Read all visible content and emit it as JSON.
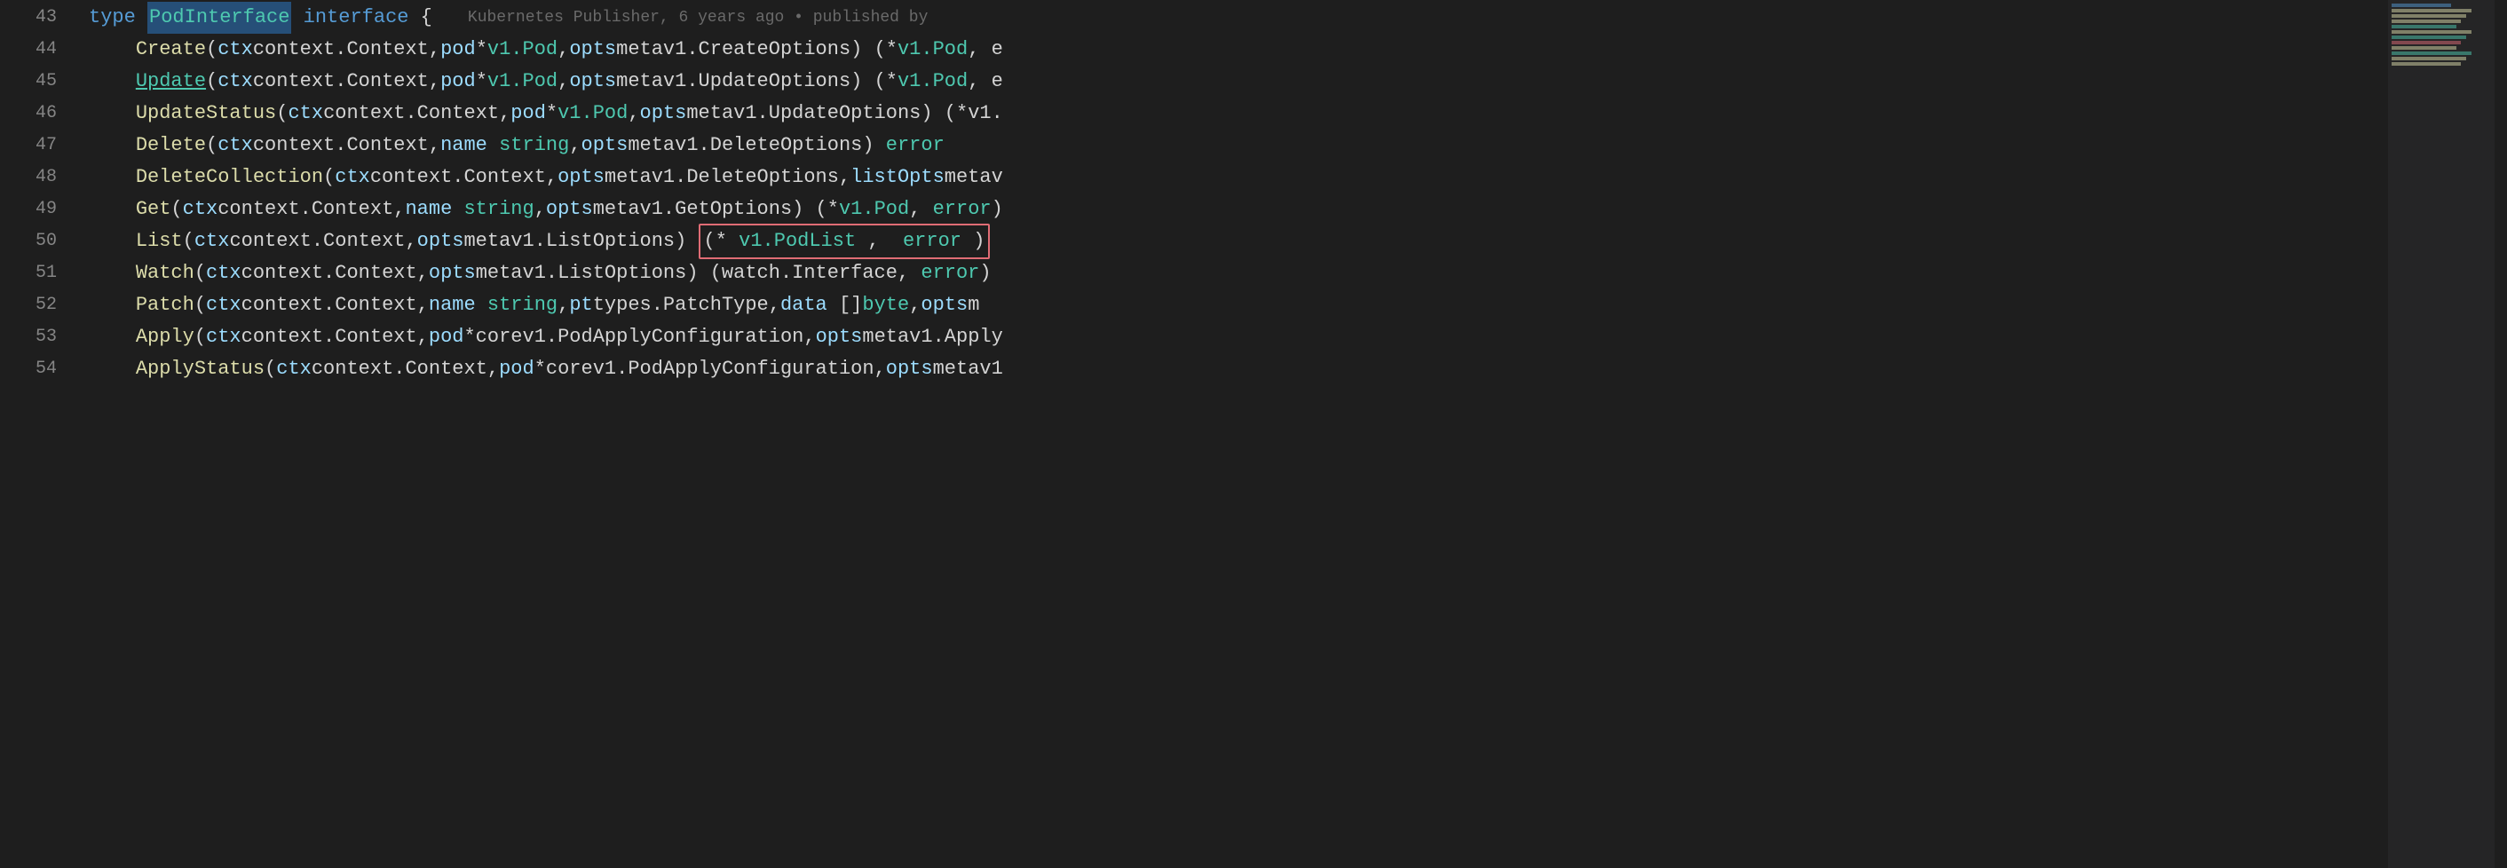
{
  "editor": {
    "background": "#1e1e1e",
    "font_size": "22px"
  },
  "blame": {
    "line43": "Kubernetes Publisher, 6 years ago • published by"
  },
  "lines": [
    {
      "number": "43",
      "tokens": [
        {
          "text": "type",
          "class": "kw-type"
        },
        {
          "text": " ",
          "class": "plain"
        },
        {
          "text": "PodInterface",
          "class": "type-name"
        },
        {
          "text": " interface {",
          "class": "punctuation"
        }
      ],
      "blame": "Kubernetes Publisher, 6 years ago • published by"
    },
    {
      "number": "44",
      "content": "    Create(ctx context.Context, pod *v1.Pod, opts metav1.CreateOptions) (*v1.Pod, e"
    },
    {
      "number": "45",
      "content": "    Update(ctx context.Context, pod *v1.Pod, opts metav1.UpdateOptions) (*v1.Pod, e",
      "underline_word": "Update"
    },
    {
      "number": "46",
      "content": "    UpdateStatus(ctx context.Context, pod *v1.Pod, opts metav1.UpdateOptions) (*v1."
    },
    {
      "number": "47",
      "content": "    Delete(ctx context.Context, name string, opts metav1.DeleteOptions) error"
    },
    {
      "number": "48",
      "content": "    DeleteCollection(ctx context.Context, opts metav1.DeleteOptions, listOpts metav"
    },
    {
      "number": "49",
      "content": "    Get(ctx context.Context, name string, opts metav1.GetOptions) (*v1.Pod, error)"
    },
    {
      "number": "50",
      "content": "    List(ctx context.Context, opts metav1.ListOptions) (*v1.PodList, error)",
      "highlight_return": true
    },
    {
      "number": "51",
      "content": "    Watch(ctx context.Context, opts metav1.ListOptions) (watch.Interface, error)"
    },
    {
      "number": "52",
      "content": "    Patch(ctx context.Context, name string, pt types.PatchType, data []byte, opts m"
    },
    {
      "number": "53",
      "content": "    Apply(ctx context.Context, pod *corev1.PodApplyConfiguration, opts metav1.Apply"
    },
    {
      "number": "54",
      "content": "    ApplyStatus(ctx context.Context, pod *corev1.PodApplyConfiguration, opts metav1"
    }
  ]
}
